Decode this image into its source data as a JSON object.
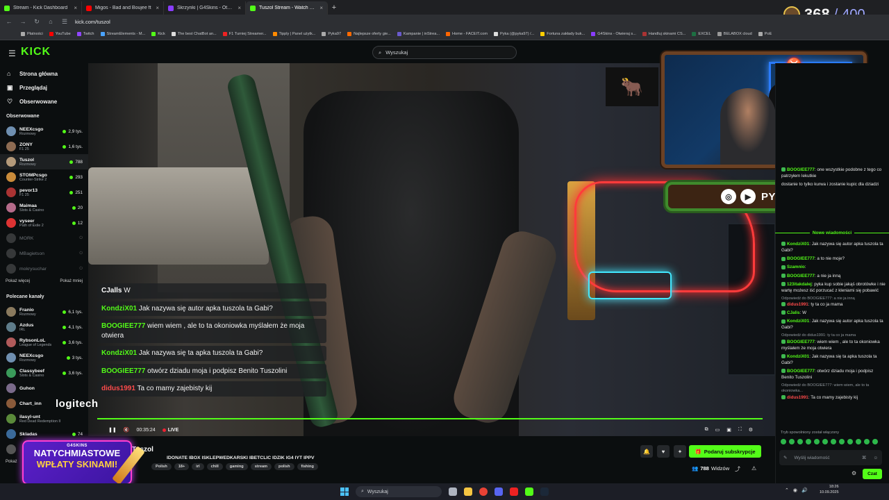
{
  "browser": {
    "tabs": [
      {
        "title": "Stream - Kick Dashboard",
        "color": "#53fc18",
        "active": false
      },
      {
        "title": "Migos - Bad and Boujee ft",
        "color": "#ff0000",
        "active": false
      },
      {
        "title": "Skrzynki | G4Skins - Otwieraj sk",
        "color": "#8a3dff",
        "active": false
      },
      {
        "title": "Tuszol Stream - Watch Live on",
        "color": "#53fc18",
        "active": true
      }
    ],
    "url": "kick.com/tuszol",
    "bookmarks": [
      "Płatności",
      "YouTube",
      "Twitch",
      "StreamElements - M...",
      "Kick",
      "The best ChatBot an...",
      "F1 Turniej Streamer...",
      "Tipply | Panel użytk...",
      "Pyka97",
      "Najlepsze oferty gie...",
      "Kampanie | inStrea...",
      "Home - FACEIT.com",
      "Pyka (@pyka97) /...",
      "Fortuna zakłady buk...",
      "G4Skins - Otwieraj s...",
      "Handluj skinami CS...",
      "EXCEL",
      "BELABOX cloud",
      "PoE"
    ],
    "counter_value": "368",
    "counter_sep": "/",
    "counter_max": "400"
  },
  "kick": {
    "logo": "KICK",
    "search_placeholder": "Wyszukaj"
  },
  "sidebar": {
    "nav": [
      {
        "label": "Strona główna",
        "icon": "home-icon",
        "glyph": "⌂"
      },
      {
        "label": "Przeglądaj",
        "icon": "browse-icon",
        "glyph": "▣"
      },
      {
        "label": "Obserwowane",
        "icon": "heart-icon",
        "glyph": "♡"
      }
    ],
    "followed_title": "Obserwowane",
    "followed": [
      {
        "name": "NEEXcsgo",
        "category": "Rozmowy",
        "viewers": "2,9 tys.",
        "color": "#6f8fb0",
        "live": true
      },
      {
        "name": "ZONY",
        "category": "F1 25",
        "viewers": "1,6 tys.",
        "color": "#8d6b52",
        "live": true
      },
      {
        "name": "Tuszol",
        "category": "Rozmowy",
        "viewers": "788",
        "color": "#b49a7a",
        "live": true,
        "active": true
      },
      {
        "name": "STOMPcsgo",
        "category": "Counter-Strike 2",
        "viewers": "293",
        "color": "#c98b3a",
        "live": true
      },
      {
        "name": "pevor13",
        "category": "F1 25",
        "viewers": "251",
        "color": "#a33",
        "live": true
      },
      {
        "name": "Maimaa",
        "category": "Slots & Casino",
        "viewers": "20",
        "color": "#b56b8a",
        "live": true
      },
      {
        "name": "vyseer",
        "category": "Path of Exile 2",
        "viewers": "12",
        "color": "#d33",
        "live": true
      },
      {
        "name": "MORK",
        "category": "",
        "viewers": "",
        "color": "#777",
        "live": false
      },
      {
        "name": "MBagietson",
        "category": "",
        "viewers": "",
        "color": "#777",
        "live": false
      },
      {
        "name": "mokrysuchar",
        "category": "",
        "viewers": "",
        "color": "#777",
        "live": false
      }
    ],
    "show_more": "Pokaż więcej",
    "show_less": "Pokaż mniej",
    "recommended_title": "Polecane kanały",
    "recommended": [
      {
        "name": "Franio",
        "category": "Rozmowy",
        "viewers": "6,1 tys.",
        "color": "#8a7a5e"
      },
      {
        "name": "Azdus",
        "category": "IRL",
        "viewers": "4,1 tys.",
        "color": "#5e7c8a"
      },
      {
        "name": "RybsonLoL",
        "category": "League of Legends",
        "viewers": "3,6 tys.",
        "color": "#b05a5a"
      },
      {
        "name": "NEEXcsgo",
        "category": "Rozmowy",
        "viewers": "3 tys.",
        "color": "#6f8fb0"
      },
      {
        "name": "Classybeef",
        "category": "Slots & Casino",
        "viewers": "3,6 tys.",
        "color": "#3a9a5a"
      },
      {
        "name": "Guhon",
        "category": "",
        "viewers": "",
        "color": "#7a6a8a"
      },
      {
        "name": "Chart_inn",
        "category": "",
        "viewers": "",
        "color": "#8a5a3a"
      },
      {
        "name": "ilasyl-unt",
        "category": "Red Dead Redemption II",
        "viewers": "",
        "color": "#5a8a3a"
      },
      {
        "name": "Skladas",
        "category": "",
        "viewers": "74",
        "color": "#3a6a9a"
      },
      {
        "name": "",
        "category": "",
        "viewers": "",
        "color": "#555"
      }
    ],
    "show_more_short": "Pokaż"
  },
  "video": {
    "overlay_chat": [
      {
        "user": "CJalls",
        "user_color": "#ffffff",
        "text": "W"
      },
      {
        "user": "KondziX01",
        "user_color": "#53fc18",
        "text": "Jak nazywa się autor apka tuszola ta Gabi?"
      },
      {
        "user": "BOOGIEE777",
        "user_color": "#53fc18",
        "text": "wiem wiem , ale to ta okoniowka myślałem że moja otwiera"
      },
      {
        "user": "KondziX01",
        "user_color": "#53fc18",
        "text": "Jak nazywa się ta apka tuszola ta Gabi?"
      },
      {
        "user": "BOOGIEE777",
        "user_color": "#53fc18",
        "text": "otwórz dziadu moja i podpisz Benito Tuszolini"
      },
      {
        "user": "didus1991",
        "user_color": "#ff4b4b",
        "text": "Ta co mamy zajebisty kij"
      }
    ],
    "sponsor": "logitech",
    "timestamp": "00:35:24",
    "live_label": "LIVE",
    "progress": 1.0,
    "social_handle": "PYKA97"
  },
  "stream": {
    "streamer": "Tuszol",
    "title": "IDONATE IBOX ISKLEPWEDKARSKI IBETCLIC IDZIK IG4 IYT IPPV",
    "tags": [
      "Polish",
      "18+",
      "irl",
      "chill",
      "gaming",
      "stream",
      "polish",
      "fishing"
    ],
    "subscribe_label": "Podaruj subskrypcje",
    "viewer_count": "788",
    "viewer_label": "Widzów"
  },
  "promo": {
    "brand": "G4SKINS",
    "line1": "NATYCHMIASTOWE",
    "line2": "WPŁATY SKINAMI!"
  },
  "chat": {
    "top_messages": [
      {
        "user": "BOOGIEE777",
        "text": "one wszystkie podobne z tego co patrzyłem lekutkie"
      },
      {
        "user": "",
        "text": "dostanie to tylko kurwa i zostanie kupic dla dziadzi"
      }
    ],
    "new_messages_label": "Nowe wiadomości",
    "messages": [
      {
        "reply": "",
        "user": "KondziX01",
        "text": "Jak nazywa się autor apka tuszola ta Gabi?"
      },
      {
        "reply": "",
        "user": "BOOGIEE777",
        "text": "a to nie moje?"
      },
      {
        "reply": "",
        "user": "Szamnio",
        "text": ""
      },
      {
        "reply": "",
        "user": "BOOGIEE777",
        "text": "a nie ja inną"
      },
      {
        "reply": "",
        "user": "123itakdalej",
        "text": "pyka kup sobie jakąś obrotówke i nie wartę możesz iść porzucać z kleniami się pobawić"
      },
      {
        "reply": "Odpowiedź do BOOGIEE777: a nie ja inną",
        "user": "didus1991",
        "text": "ty ta co ja mama"
      },
      {
        "reply": "",
        "user": "CJalis",
        "text": "W"
      },
      {
        "reply": "",
        "user": "KondziX01",
        "text": "Jak nazywa się autor apka tuszola ta Gabi?"
      },
      {
        "reply": "Odpowiedź do didus1991: ty ta co ja mama",
        "user": "BOOGIEE777",
        "text": "wiem wiem , ale to ta okoniowka myślałem że moja otwiera"
      },
      {
        "reply": "",
        "user": "KondziX01",
        "text": "Jak nazywa się ta apka tuszola ta Gabi?"
      },
      {
        "reply": "",
        "user": "BOOGIEE777",
        "text": "otwórz dziadu moja i podpisz Benito Tuszolini"
      },
      {
        "reply": "Odpowiedź do BOOGIEE777: wiem wiem, ale to ta okoniowka...",
        "user": "didus1991",
        "text": "Ta co mamy zajebisty kij"
      }
    ],
    "slow_mode": "Tryb spowolniony został włączony",
    "input_placeholder": "Wyślij wiadomość",
    "send_label": "Czat"
  },
  "taskbar": {
    "search_placeholder": "Wyszukaj",
    "time": "18:26",
    "date": "10.09.2025"
  }
}
